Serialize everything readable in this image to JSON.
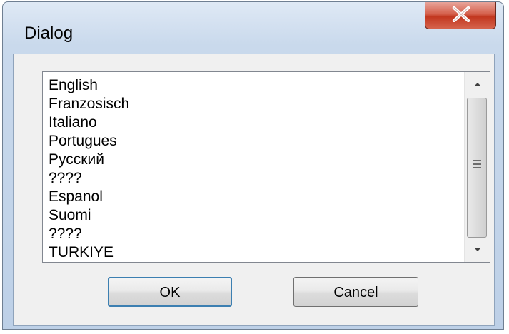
{
  "window": {
    "title": "Dialog"
  },
  "titlebar": {
    "close_icon": "close-x-icon"
  },
  "listbox": {
    "items": [
      "English",
      "Franzosisch",
      "Italiano",
      "Portugues",
      "Русский",
      "????",
      "Espanol",
      "Suomi",
      "????",
      "TURKIYE"
    ],
    "scrollbar": {
      "up_icon": "scroll-up-arrow-icon",
      "down_icon": "scroll-down-arrow-icon",
      "grip_icon": "scroll-grip-icon"
    }
  },
  "buttons": {
    "ok_label": "OK",
    "cancel_label": "Cancel"
  },
  "colors": {
    "close_button": "#c2371f",
    "window_frame": "#bdd0e7",
    "default_button_border": "#3c7fb1"
  }
}
